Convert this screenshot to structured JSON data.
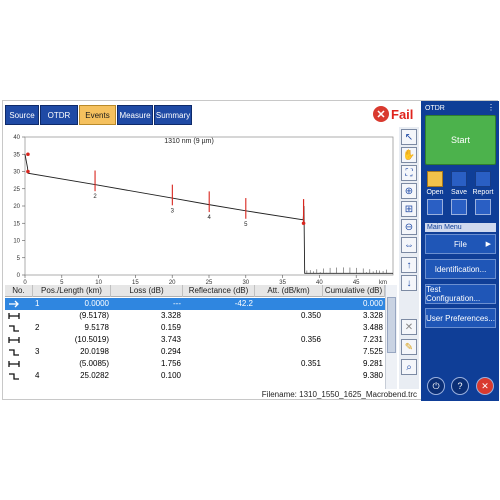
{
  "tabs": [
    {
      "label": "Source",
      "active": false
    },
    {
      "label": "OTDR",
      "active": false
    },
    {
      "label": "Events",
      "active": true
    },
    {
      "label": "Measure",
      "active": false
    },
    {
      "label": "Summary",
      "active": false
    }
  ],
  "status": {
    "label": "Fail",
    "color": "#e0241d"
  },
  "chart_data": {
    "type": "line",
    "title": "1310 nm (9 µm)",
    "xlabel": "km",
    "ylabel": "",
    "xlim": [
      0,
      50
    ],
    "ylim": [
      0,
      40
    ],
    "xticks": [
      0,
      5,
      10,
      15,
      20,
      25,
      30,
      35,
      40,
      45
    ],
    "yticks": [
      0,
      5,
      10,
      15,
      20,
      25,
      30,
      35,
      40
    ],
    "series": [
      {
        "x": [
          0,
          0.35,
          0.4,
          9.5,
          20.0,
          25.0,
          30.0,
          37.8,
          37.9,
          38.0,
          50.0
        ],
        "y": [
          35.0,
          31.0,
          29.5,
          26.2,
          22.3,
          20.4,
          18.6,
          16.0,
          20.0,
          0.5,
          0.5
        ]
      }
    ],
    "event_markers": [
      {
        "label": "2",
        "x": 9.5178
      },
      {
        "label": "3",
        "x": 20.0198
      },
      {
        "label": "4",
        "x": 25.0282
      },
      {
        "label": "5",
        "x": 30.0
      }
    ]
  },
  "tools": [
    "select-arrow-icon",
    "hand-icon",
    "zoom-fit-icon",
    "zoom-in-icon",
    "zoom-area-icon",
    "zoom-out-icon",
    "zoom-horizontal-icon",
    "arrow-up-icon",
    "arrow-down-icon",
    "delete-icon",
    "edit-icon",
    "search-icon"
  ],
  "table": {
    "columns": [
      "No.",
      "Pos./Length (km)",
      "Loss (dB)",
      "Reflectance (dB)",
      "Att. (dB/km)",
      "Cumulative (dB)"
    ],
    "rows": [
      {
        "no": "1",
        "pos": "0.0000",
        "loss": "---",
        "refl": "-42.2",
        "att": "",
        "cum": "0.000",
        "selected": true,
        "icon": "launch-arrow-icon"
      },
      {
        "no": "",
        "pos": "(9.5178)",
        "loss": "3.328",
        "refl": "",
        "att": "0.350",
        "cum": "3.328",
        "selected": false,
        "icon": "span-icon"
      },
      {
        "no": "2",
        "pos": "9.5178",
        "loss": "0.159",
        "refl": "",
        "att": "",
        "cum": "3.488",
        "selected": false,
        "icon": "step-down-icon"
      },
      {
        "no": "",
        "pos": "(10.5019)",
        "loss": "3.743",
        "refl": "",
        "att": "0.356",
        "cum": "7.231",
        "selected": false,
        "icon": "span-icon"
      },
      {
        "no": "3",
        "pos": "20.0198",
        "loss": "0.294",
        "refl": "",
        "att": "",
        "cum": "7.525",
        "selected": false,
        "icon": "step-down-icon"
      },
      {
        "no": "",
        "pos": "(5.0085)",
        "loss": "1.756",
        "refl": "",
        "att": "0.351",
        "cum": "9.281",
        "selected": false,
        "icon": "span-icon"
      },
      {
        "no": "4",
        "pos": "25.0282",
        "loss": "0.100",
        "refl": "",
        "att": "",
        "cum": "9.380",
        "selected": false,
        "icon": "step-down-icon"
      }
    ]
  },
  "filename": "Filename: 1310_1550_1625_Macrobend.trc",
  "side": {
    "title": "OTDR",
    "start": "Start",
    "actions": [
      {
        "label": "Open",
        "icon": "folder-icon"
      },
      {
        "label": "Save",
        "icon": "save-icon"
      },
      {
        "label": "Report",
        "icon": "report-icon"
      }
    ],
    "main_menu": "Main Menu",
    "file": "File",
    "menu": [
      "Identification...",
      "Test Configuration...",
      "User Preferences..."
    ],
    "bottom": [
      "power-icon",
      "help-icon",
      "close-icon"
    ]
  }
}
